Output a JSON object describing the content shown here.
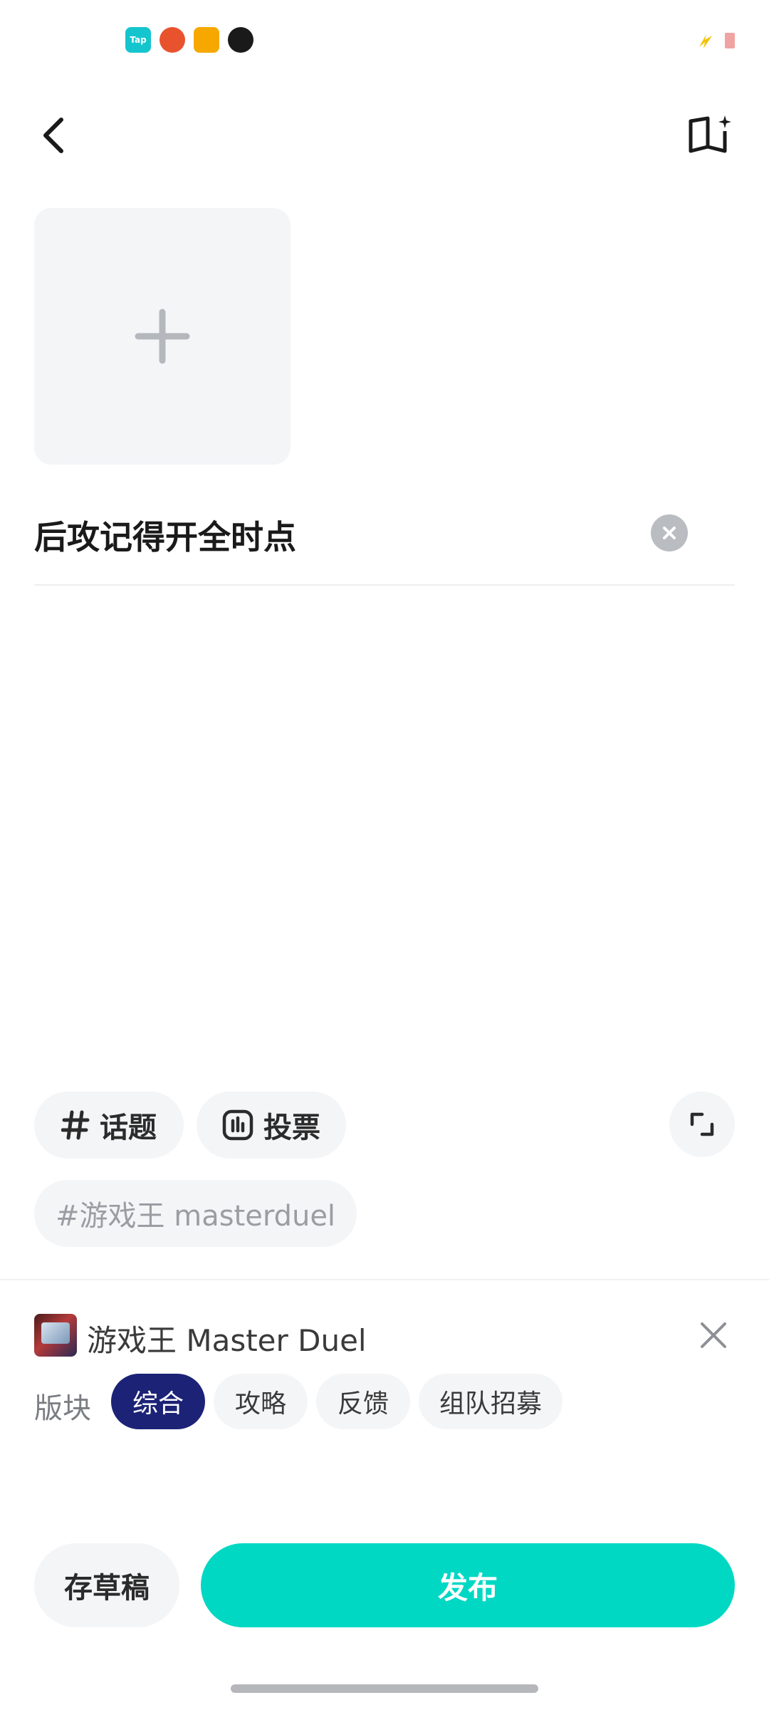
{
  "status_bar": {
    "notification_icons": [
      "tap-icon",
      "robot-icon",
      "note-icon",
      "qq-icon"
    ],
    "tap_label": "Tap",
    "battery_color": "#f0a3a3"
  },
  "header": {
    "back_icon": "back-arrow-icon",
    "guide_icon": "guide-book-icon"
  },
  "editor": {
    "add_image_icon": "plus-icon",
    "title_value": "后攻记得开全时点"
  },
  "tools": {
    "topic_label": "话题",
    "vote_label": "投票",
    "expand_icon": "expand-icon",
    "selected_tag": "#游戏王 masterduel"
  },
  "game": {
    "name": "游戏王 Master Duel",
    "close_icon": "close-icon"
  },
  "section": {
    "label": "版块",
    "options": [
      "综合",
      "攻略",
      "反馈",
      "组队招募"
    ],
    "selected": "综合"
  },
  "actions": {
    "draft_label": "存草稿",
    "publish_label": "发布"
  },
  "colors": {
    "accent": "#00d8c4",
    "selected_section": "#1c2276",
    "chip_bg": "#f4f5f7"
  }
}
